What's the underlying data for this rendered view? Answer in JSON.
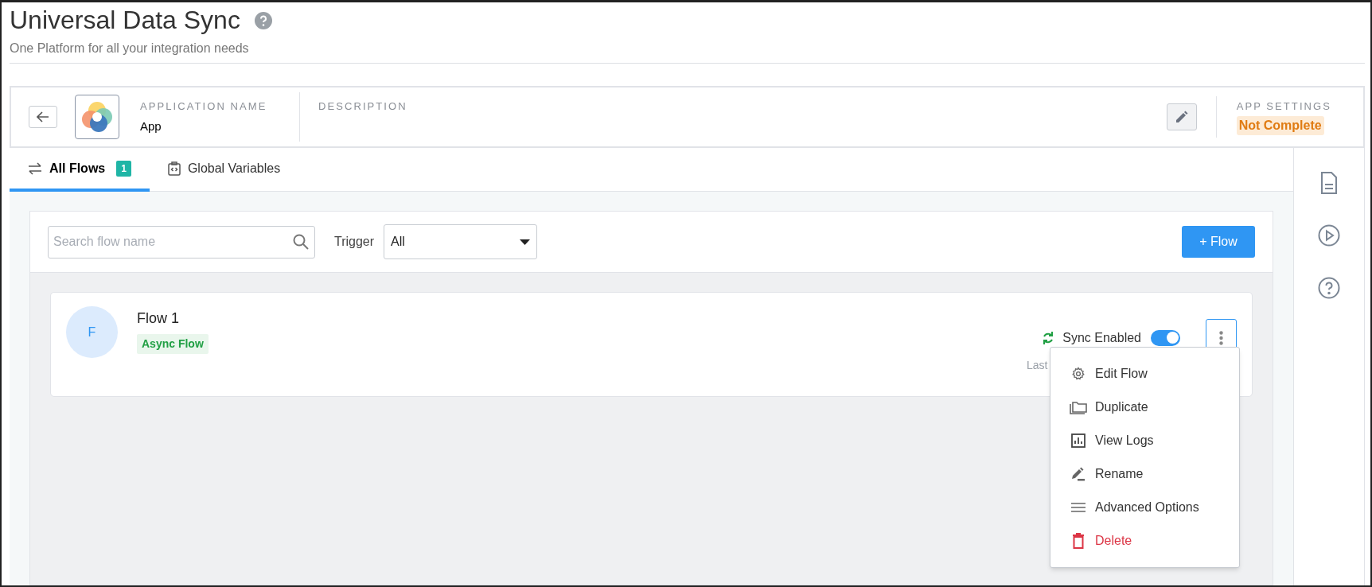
{
  "header": {
    "title": "Universal Data Sync",
    "subtitle": "One Platform for all your integration needs"
  },
  "app": {
    "name_label": "APPLICATION NAME",
    "name": "App",
    "description_label": "DESCRIPTION",
    "settings_label": "APP SETTINGS",
    "settings_status": "Not Complete"
  },
  "tabs": [
    {
      "label": "All Flows",
      "count": "1",
      "selected": true
    },
    {
      "label": "Global Variables",
      "selected": false
    }
  ],
  "toolbar": {
    "search_placeholder": "Search flow name",
    "trigger_label": "Trigger",
    "trigger_value": "All",
    "add_button": "+ Flow"
  },
  "flows": [
    {
      "initial": "F",
      "name": "Flow 1",
      "type": "Async Flow",
      "sync_label": "Sync Enabled",
      "sync_on": true,
      "last_text": "Last"
    }
  ],
  "menu": [
    {
      "label": "Edit Flow",
      "kind": "normal"
    },
    {
      "label": "Duplicate",
      "kind": "normal"
    },
    {
      "label": "View Logs",
      "kind": "normal"
    },
    {
      "label": "Rename",
      "kind": "normal"
    },
    {
      "label": "Advanced Options",
      "kind": "normal"
    },
    {
      "label": "Delete",
      "kind": "danger"
    }
  ]
}
